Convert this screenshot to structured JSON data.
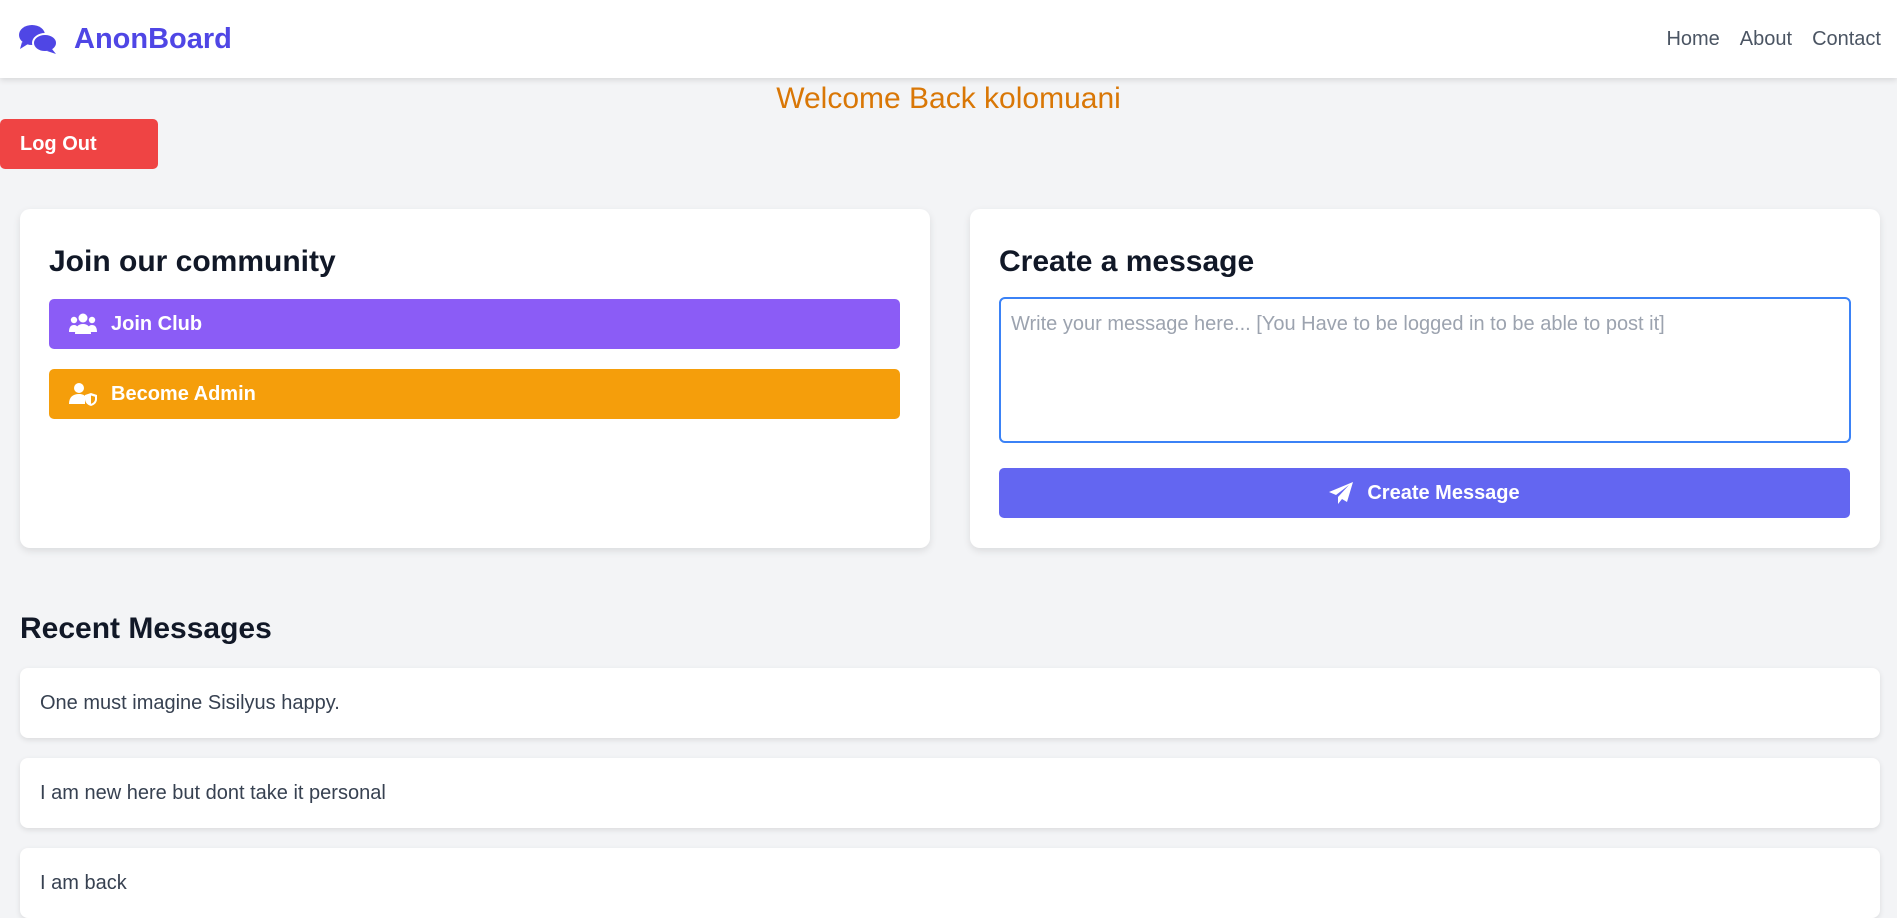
{
  "navbar": {
    "brand": "AnonBoard",
    "links": [
      "Home",
      "About",
      "Contact"
    ],
    "brand_color": "#4f46e5"
  },
  "welcome": {
    "text": "Welcome Back kolomuani"
  },
  "logout": {
    "label": "Log Out",
    "color": "#ef4444"
  },
  "community": {
    "title": "Join our community",
    "join_label": "Join Club",
    "join_icon": "users-icon",
    "join_color": "#8b5cf6",
    "admin_label": "Become Admin",
    "admin_icon": "user-shield-icon",
    "admin_color": "#f59e0b"
  },
  "create": {
    "title": "Create a message",
    "placeholder": "Write your message here... [You Have to be logged in to be able to post it]",
    "value": "",
    "button_label": "Create Message",
    "button_icon": "paper-plane-icon",
    "button_color": "#6366f1"
  },
  "recent": {
    "title": "Recent Messages",
    "messages": [
      "One must imagine Sisilyus happy.",
      "I am new here but dont take it personal",
      "I am back"
    ]
  }
}
